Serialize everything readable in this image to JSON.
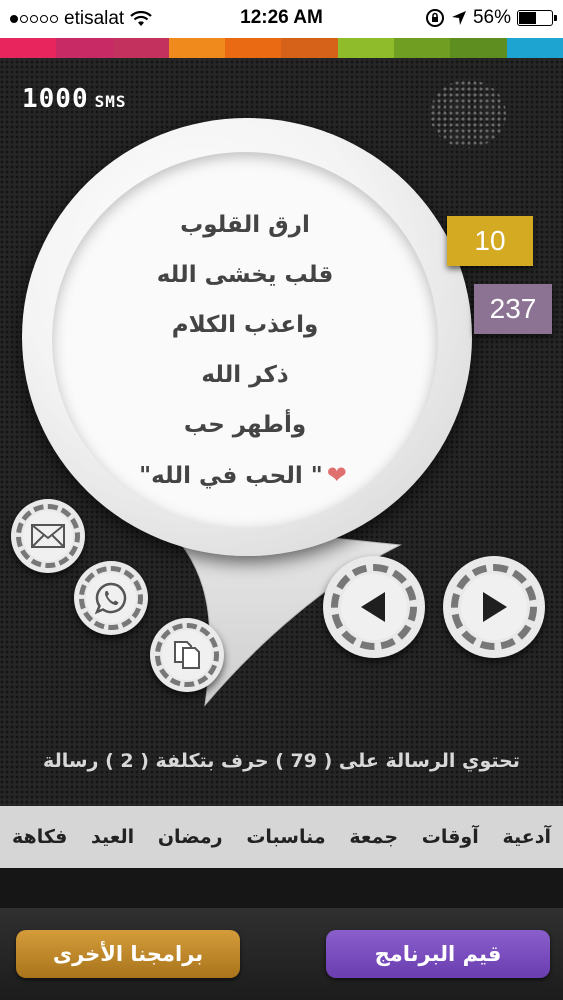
{
  "status_bar": {
    "carrier": "etisalat",
    "signal_dots_filled": 1,
    "signal_dots_total": 5,
    "time": "12:26 AM",
    "battery": "56%",
    "battery_level": 0.56
  },
  "stripe_colors": [
    "#e8255c",
    "#c82a66",
    "#c3325f",
    "#f08a1c",
    "#e96a12",
    "#d6621a",
    "#8ebc2a",
    "#6f9e22",
    "#5d8e1f",
    "#1da4d1"
  ],
  "header": {
    "counter_value": "1000",
    "counter_unit": "SMS"
  },
  "message": {
    "lines": [
      "ارق القلوب",
      "قلب يخشى الله",
      "واعذب الكلام",
      "ذكر الله",
      "وأطهر حب",
      "\" الحب في الله\""
    ],
    "heart_icon": "heart-icon"
  },
  "badges": {
    "current": "10",
    "total": "237"
  },
  "share": {
    "email_icon": "envelope-icon",
    "whatsapp_icon": "whatsapp-icon",
    "copy_icon": "copy-icon"
  },
  "navigation": {
    "prev_icon": "play-left-icon",
    "next_icon": "play-right-icon"
  },
  "info_text": "تحتوي الرسالة على ( 79 ) حرف بتكلفة ( 2 ) رسالة",
  "categories": [
    "آدعية",
    "آوقات",
    "جمعة",
    "مناسبات",
    "رمضان",
    "العيد",
    "فكاهة"
  ],
  "buttons": {
    "other_apps": "برامجنا الأخرى",
    "rate_app": "قيم البرنامج"
  },
  "colors": {
    "badge_yellow": "#d4aa22",
    "badge_purple": "#8c7394",
    "button_gold": "#c08a2c",
    "button_violet": "#7a4fbf"
  }
}
